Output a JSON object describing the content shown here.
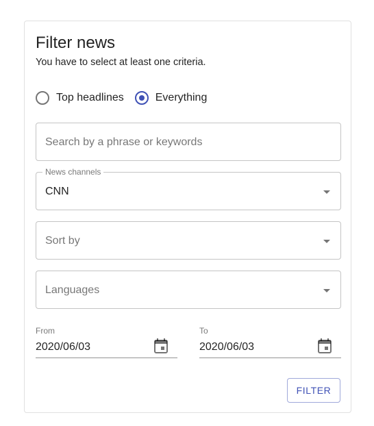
{
  "form": {
    "title": "Filter news",
    "subtitle": "You have to select at least one criteria.",
    "radio_options": [
      {
        "label": "Top headlines",
        "checked": false
      },
      {
        "label": "Everything",
        "checked": true
      }
    ],
    "search": {
      "placeholder": "Search by a phrase or keywords",
      "value": ""
    },
    "news_channels": {
      "label": "News channels",
      "value": "CNN"
    },
    "sort_by": {
      "placeholder": "Sort by",
      "value": ""
    },
    "languages": {
      "placeholder": "Languages",
      "value": ""
    },
    "from": {
      "label": "From",
      "value": "2020/06/03"
    },
    "to": {
      "label": "To",
      "value": "2020/06/03"
    },
    "filter_label": "FILTER"
  },
  "icons": {
    "radio": "radio-icon",
    "dropdown": "chevron-down-icon",
    "calendar": "calendar-icon"
  },
  "colors": {
    "accent": "#3f51b5"
  }
}
